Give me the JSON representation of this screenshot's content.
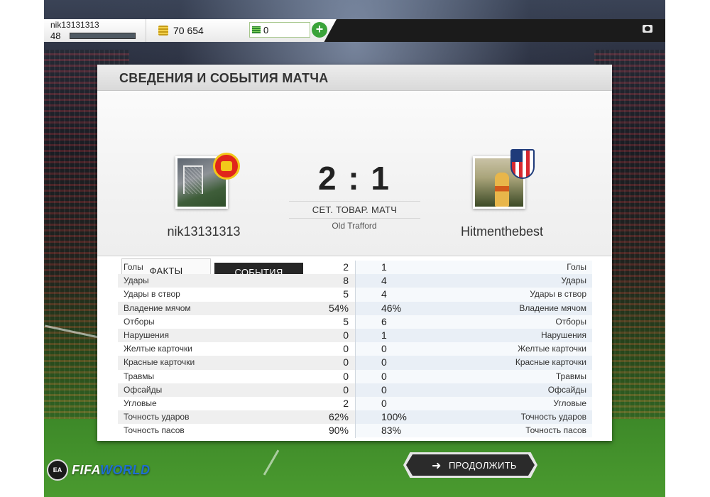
{
  "profile": {
    "username": "nik13131313",
    "level": "48"
  },
  "currency": {
    "coins": "70 654",
    "points": "0",
    "add_label": "+"
  },
  "panel": {
    "title": "СВЕДЕНИЯ И СОБЫТИЯ МАТЧА",
    "home_team": {
      "name": "nik13131313",
      "badge_icon": "manchester-united-crest"
    },
    "away_team": {
      "name": "Hitmenthebest",
      "badge_icon": "atletico-madrid-crest"
    },
    "score": "2 : 1",
    "match_type": "СЕТ. ТОВАР. МАТЧ",
    "venue": "Old Trafford"
  },
  "tabs": [
    {
      "label": "ФАКТЫ",
      "active": true
    },
    {
      "label": "СОБЫТИЯ",
      "active": false
    }
  ],
  "stats": [
    {
      "label": "Голы",
      "home": "2",
      "away": "1"
    },
    {
      "label": "Удары",
      "home": "8",
      "away": "4"
    },
    {
      "label": "Удары в створ",
      "home": "5",
      "away": "4"
    },
    {
      "label": "Владение мячом",
      "home": "54%",
      "away": "46%"
    },
    {
      "label": "Отборы",
      "home": "5",
      "away": "6"
    },
    {
      "label": "Нарушения",
      "home": "0",
      "away": "1"
    },
    {
      "label": "Желтые карточки",
      "home": "0",
      "away": "0"
    },
    {
      "label": "Красные карточки",
      "home": "0",
      "away": "0"
    },
    {
      "label": "Травмы",
      "home": "0",
      "away": "0"
    },
    {
      "label": "Офсайды",
      "home": "0",
      "away": "0"
    },
    {
      "label": "Угловые",
      "home": "2",
      "away": "0"
    },
    {
      "label": "Точность ударов",
      "home": "62%",
      "away": "100%"
    },
    {
      "label": "Точность пасов",
      "home": "90%",
      "away": "83%"
    }
  ],
  "footer": {
    "logo_ea": "EA",
    "logo_text_1": "FIFA",
    "logo_text_2": "WORLD",
    "continue_label": "ПРОДОЛЖИТЬ",
    "continue_arrow": "➜"
  },
  "colors": {
    "accent_green": "#3aa33a",
    "dark_button": "#2b2b2b",
    "panel_bg": "#ffffff"
  }
}
